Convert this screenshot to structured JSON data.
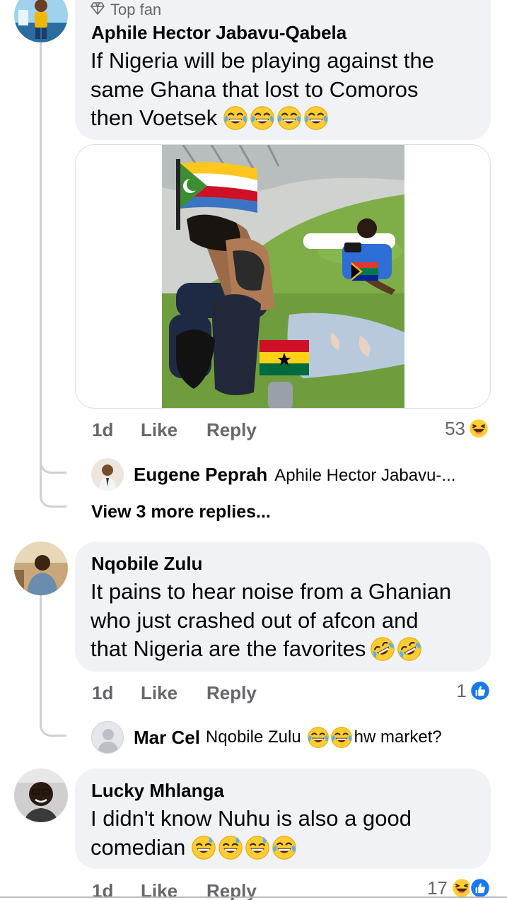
{
  "comments": [
    {
      "badge_label": "Top fan",
      "author": "Aphile Hector Jabavu-Qabela",
      "text_lines": [
        "If Nigeria will be playing against the",
        "same Ghana that lost to Comoros",
        "then Voetsek"
      ],
      "line_end_emojis": [
        "joy-emoji",
        "joy-emoji",
        "joy-emoji",
        "joy-emoji"
      ],
      "time": "1d",
      "like_label": "Like",
      "reply_label": "Reply",
      "reaction_count": "53",
      "reaction_icons": [
        "haha-reaction-icon"
      ],
      "attachment": {
        "type": "meme-photo",
        "flags": [
          "comoros-flag",
          "south-africa-flag",
          "ghana-flag"
        ]
      },
      "reply_preview": {
        "author": "Eugene Peprah",
        "text": "Aphile Hector Jabavu-..."
      },
      "view_more_replies": "View 3 more replies..."
    },
    {
      "author": "Nqobile Zulu",
      "text_lines": [
        "It pains to hear noise from a Ghanian",
        "who just crashed out of afcon and",
        "that Nigeria are the favorites"
      ],
      "line_end_emojis": [
        "rofl-emoji",
        "rofl-emoji"
      ],
      "time": "1d",
      "like_label": "Like",
      "reply_label": "Reply",
      "reaction_count": "1",
      "reaction_icons": [
        "like-reaction-icon"
      ],
      "reply_preview": {
        "author": "Mar Cel",
        "text_before": "Nqobile Zulu",
        "emojis": [
          "joy-emoji",
          "joy-emoji"
        ],
        "text_after": "hw market?"
      }
    },
    {
      "author": "Lucky Mhlanga",
      "text_lines": [
        "I didn't know Nuhu is also a good",
        "comedian"
      ],
      "line_end_emojis": [
        "sweat-smile-emoji",
        "sweat-smile-emoji",
        "sweat-smile-emoji",
        "joy-emoji"
      ],
      "time": "1d",
      "like_label": "Like",
      "reply_label": "Reply",
      "reaction_count": "17",
      "reaction_icons": [
        "haha-reaction-icon",
        "like-reaction-icon"
      ]
    }
  ],
  "colors": {
    "bubble_bg": "#f0f2f5",
    "meta_text": "#65676b",
    "like_blue": "#1877f2",
    "emoji_yellow": "#ffcc33",
    "thread_line": "#ced0d4"
  }
}
